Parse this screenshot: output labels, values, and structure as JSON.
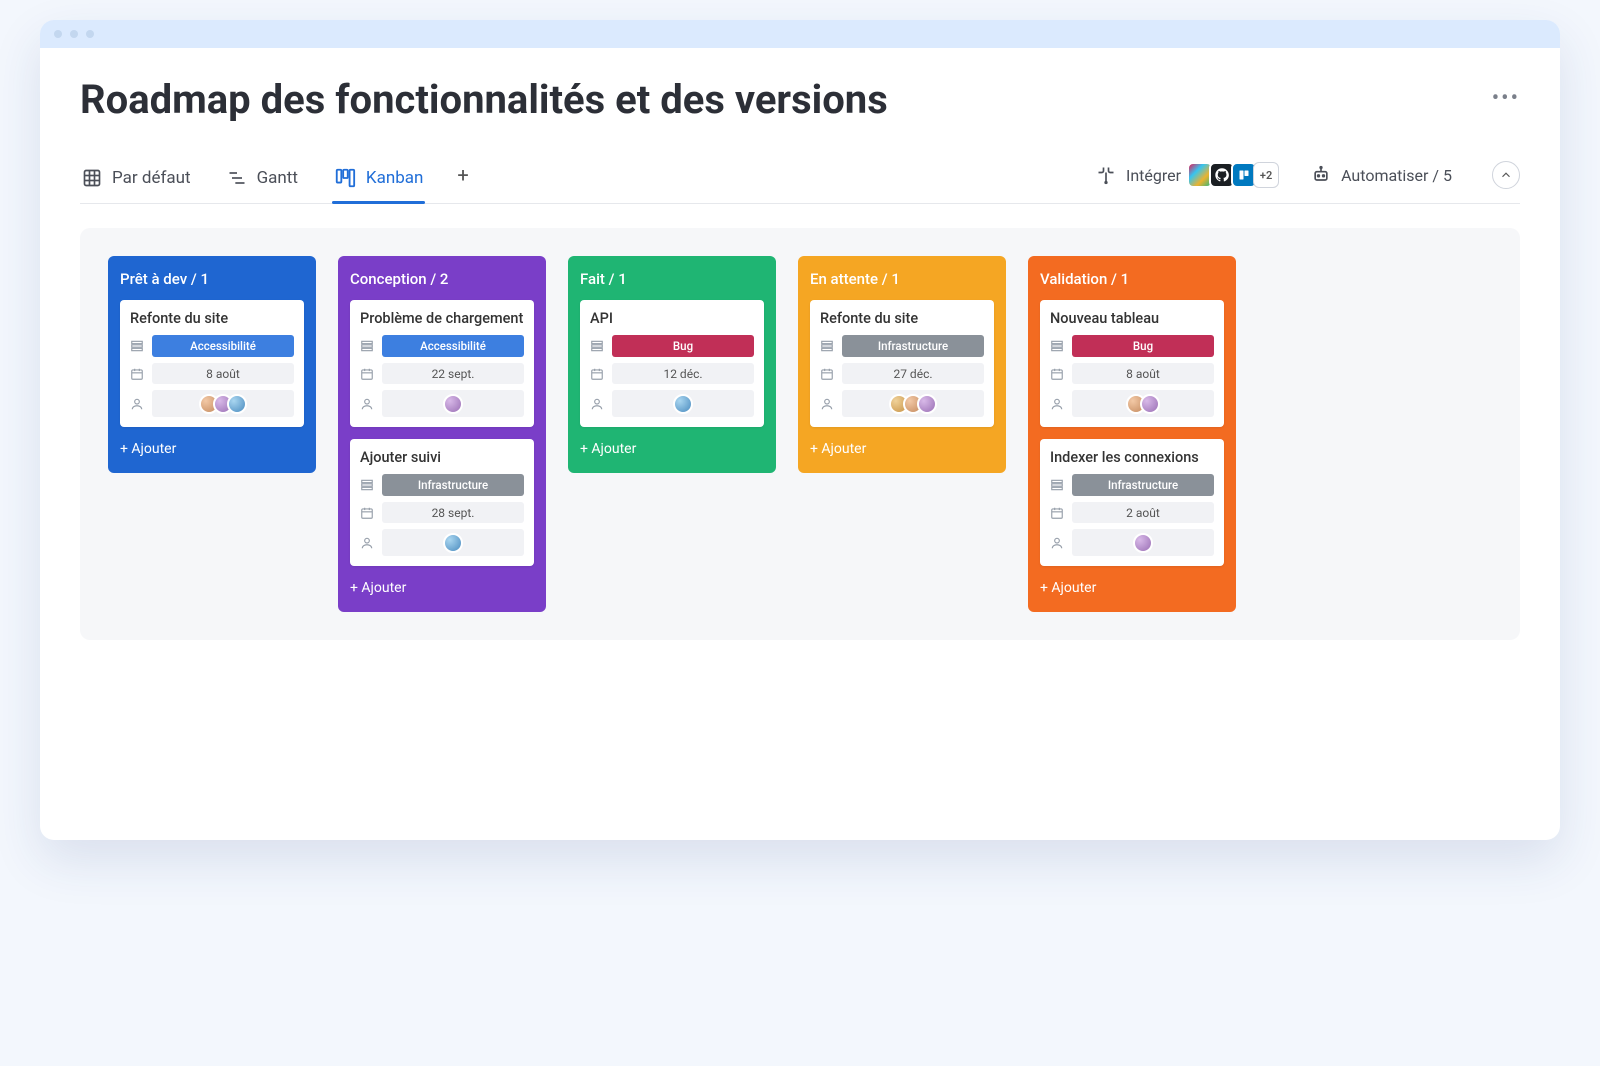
{
  "page": {
    "title": "Roadmap des fonctionnalités et des versions"
  },
  "toolbar": {
    "views": [
      {
        "label": "Par défaut",
        "icon": "grid",
        "active": false
      },
      {
        "label": "Gantt",
        "icon": "gantt",
        "active": false
      },
      {
        "label": "Kanban",
        "icon": "kanban",
        "active": true
      }
    ],
    "integrate_label": "Intégrer",
    "integrate_more": "+2",
    "automate_label": "Automatiser / 5"
  },
  "tags": {
    "accessibilite": {
      "label": "Accessibilité",
      "color": "#3d7fe0"
    },
    "bug": {
      "label": "Bug",
      "color": "#c12f57"
    },
    "infrastructure": {
      "label": "Infrastructure",
      "color": "#8a9199"
    }
  },
  "columns": [
    {
      "key": "pret",
      "title": "Prêt à dev / 1",
      "color": "#1f66d1",
      "add_label": "+ Ajouter",
      "cards": [
        {
          "title": "Refonte du site",
          "tag": "accessibilite",
          "date": "8 août",
          "avatars": 3
        }
      ]
    },
    {
      "key": "conception",
      "title": "Conception / 2",
      "color": "#7a3ec8",
      "add_label": "+ Ajouter",
      "cards": [
        {
          "title": "Problème de chargement",
          "tag": "accessibilite",
          "date": "22 sept.",
          "avatars": 1
        },
        {
          "title": "Ajouter suivi",
          "tag": "infrastructure",
          "date": "28 sept.",
          "avatars": 1
        }
      ]
    },
    {
      "key": "fait",
      "title": "Fait / 1",
      "color": "#1fb573",
      "add_label": "+ Ajouter",
      "cards": [
        {
          "title": "API",
          "tag": "bug",
          "date": "12 déc.",
          "avatars": 1
        }
      ]
    },
    {
      "key": "attente",
      "title": "En attente / 1",
      "color": "#f5a623",
      "add_label": "+ Ajouter",
      "cards": [
        {
          "title": "Refonte du site",
          "tag": "infrastructure",
          "date": "27 déc.",
          "avatars": 3
        }
      ]
    },
    {
      "key": "validation",
      "title": "Validation / 1",
      "color": "#f36b21",
      "add_label": "+ Ajouter",
      "cards": [
        {
          "title": "Nouveau tableau",
          "tag": "bug",
          "date": "8 août",
          "avatars": 2
        },
        {
          "title": "Indexer les connexions",
          "tag": "infrastructure",
          "date": "2 août",
          "avatars": 1
        }
      ]
    }
  ]
}
